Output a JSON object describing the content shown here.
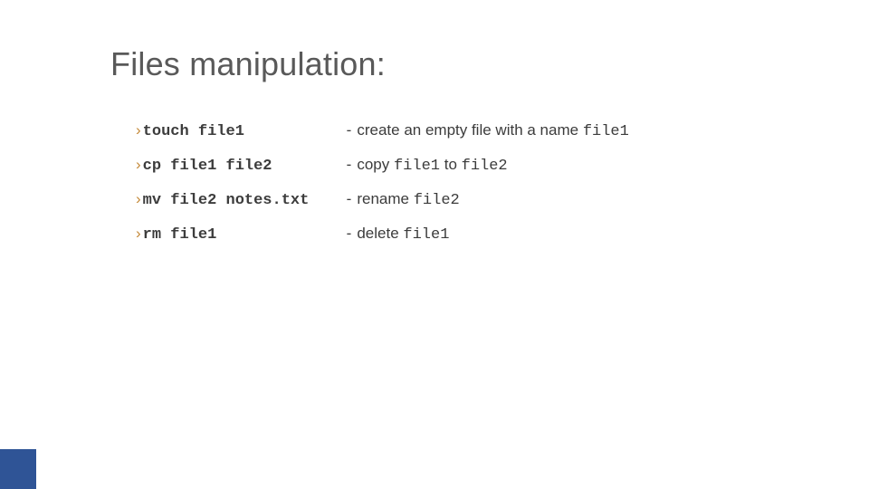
{
  "title": "Files manipulation:",
  "rows": [
    {
      "bullet": "›",
      "cmd": "touch file1",
      "dash": "-",
      "desc_pre": "create an empty file with a name ",
      "desc_mono": "file1",
      "desc_mid": "",
      "desc_mono2": "",
      "desc_post": ""
    },
    {
      "bullet": "›",
      "cmd": "cp file1 file2",
      "dash": "-",
      "desc_pre": "copy ",
      "desc_mono": "file1",
      "desc_mid": " to ",
      "desc_mono2": "file2",
      "desc_post": ""
    },
    {
      "bullet": "›",
      "cmd": "mv file2 notes.txt",
      "dash": "-",
      "desc_pre": "rename ",
      "desc_mono": "file2",
      "desc_mid": "",
      "desc_mono2": "",
      "desc_post": ""
    },
    {
      "bullet": "›",
      "cmd": "rm file1",
      "dash": "-",
      "desc_pre": "delete ",
      "desc_mono": "file1",
      "desc_mid": "",
      "desc_mono2": "",
      "desc_post": ""
    }
  ]
}
